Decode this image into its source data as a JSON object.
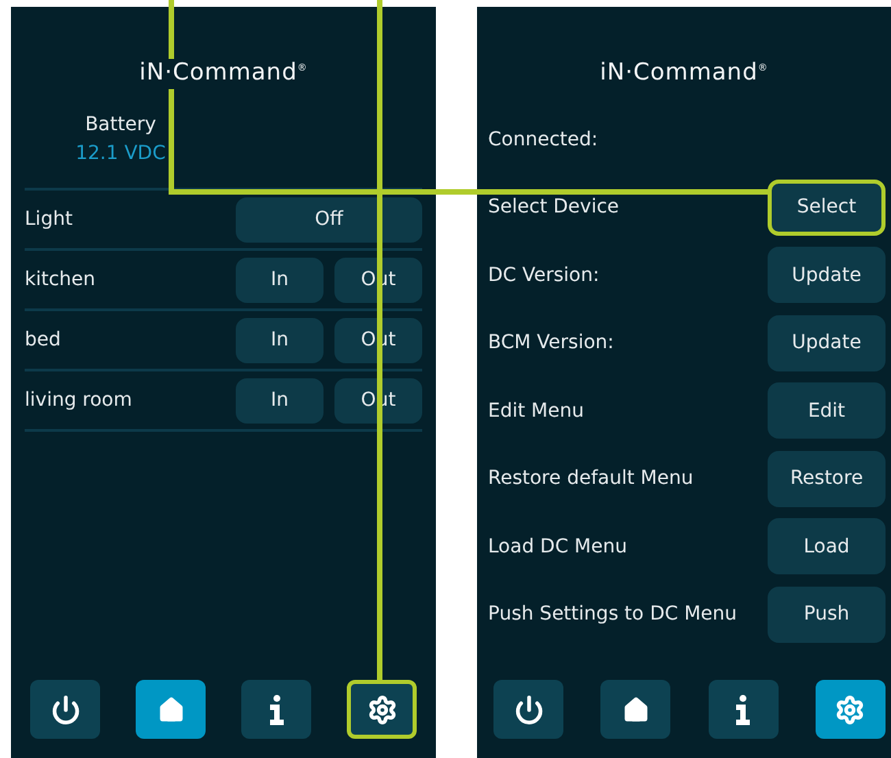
{
  "screens": [
    {
      "logo": "iN·Command$^{®}$",
      "battery": {
        "label": "Battery",
        "value": "12.1 VDC"
      },
      "rows": [
        {
          "kind": "single",
          "label": "Light",
          "buttons": [
            "Off"
          ]
        },
        {
          "kind": "pair",
          "label": "kitchen",
          "buttons": [
            "In",
            "Out"
          ]
        },
        {
          "kind": "pair",
          "label": "bed",
          "buttons": [
            "In",
            "Out"
          ]
        },
        {
          "kind": "pair",
          "label": "living room",
          "buttons": [
            "In",
            "Out"
          ]
        }
      ],
      "nav": [
        {
          "kind": "power",
          "selected": false,
          "highlighted": false
        },
        {
          "kind": "home",
          "selected": true,
          "highlighted": false
        },
        {
          "kind": "info",
          "selected": false,
          "highlighted": false
        },
        {
          "kind": "settings",
          "selected": false,
          "highlighted": true
        }
      ]
    },
    {
      "logo": "iN·Command$^{®}$",
      "settings": [
        {
          "label": "Connected:"
        },
        {
          "label": "Select Device",
          "button": "Select",
          "highlighted": true
        },
        {
          "label": "DC Version:",
          "button": "Update",
          "highlighted": false
        },
        {
          "label": "BCM Version:",
          "button": "Update",
          "highlighted": false
        },
        {
          "label": "Edit Menu",
          "button": "Edit",
          "highlighted": false
        },
        {
          "label": "Restore default Menu",
          "button": "Restore",
          "highlighted": false
        },
        {
          "label": "Load DC Menu",
          "button": "Load",
          "highlighted": false
        },
        {
          "label": "Push Settings to DC Menu",
          "button": "Push",
          "highlighted": false
        }
      ],
      "nav": [
        {
          "kind": "power",
          "selected": false,
          "highlighted": false
        },
        {
          "kind": "home",
          "selected": false,
          "highlighted": false
        },
        {
          "kind": "info",
          "selected": false,
          "highlighted": false
        },
        {
          "kind": "settings",
          "selected": true,
          "highlighted": false
        }
      ]
    }
  ]
}
